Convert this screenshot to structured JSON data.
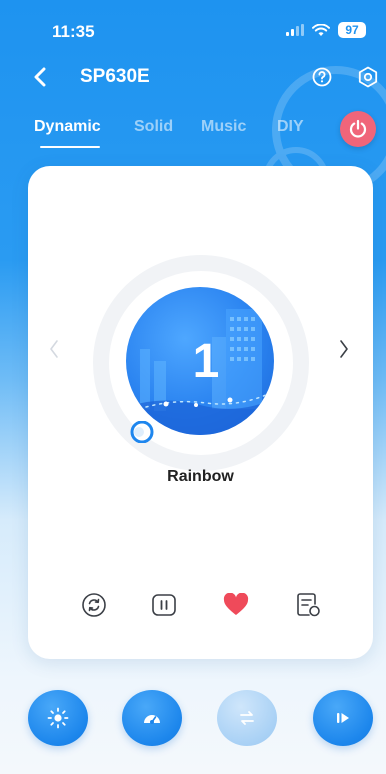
{
  "status_bar": {
    "time": "11:35",
    "battery": "97"
  },
  "header": {
    "title": "SP630E",
    "back_icon": "chevron-left-icon",
    "help_icon": "question-circle-icon",
    "settings_icon": "gear-icon"
  },
  "tabs": [
    {
      "label": "Dynamic",
      "active": true
    },
    {
      "label": "Solid",
      "active": false
    },
    {
      "label": "Music",
      "active": false
    },
    {
      "label": "DIY",
      "active": false
    }
  ],
  "power": {
    "icon": "power-icon",
    "color": "#f0657a"
  },
  "scene": {
    "number": "1",
    "mode_name": "Rainbow"
  },
  "actions": [
    {
      "name": "loop",
      "icon": "loop-icon"
    },
    {
      "name": "pause",
      "icon": "pause-icon"
    },
    {
      "name": "favorite",
      "icon": "heart-icon",
      "color": "#ef4a5a"
    },
    {
      "name": "playlist",
      "icon": "playlist-icon"
    }
  ],
  "bottom_buttons": [
    {
      "name": "brightness",
      "icon": "sun-icon"
    },
    {
      "name": "speed",
      "icon": "speed-gauge-icon"
    },
    {
      "name": "swap",
      "icon": "swap-icon",
      "disabled": true
    },
    {
      "name": "play",
      "icon": "play-icon"
    }
  ],
  "colors": {
    "accent": "#1e93f0",
    "power": "#f0657a",
    "heart": "#ef4a5a"
  }
}
